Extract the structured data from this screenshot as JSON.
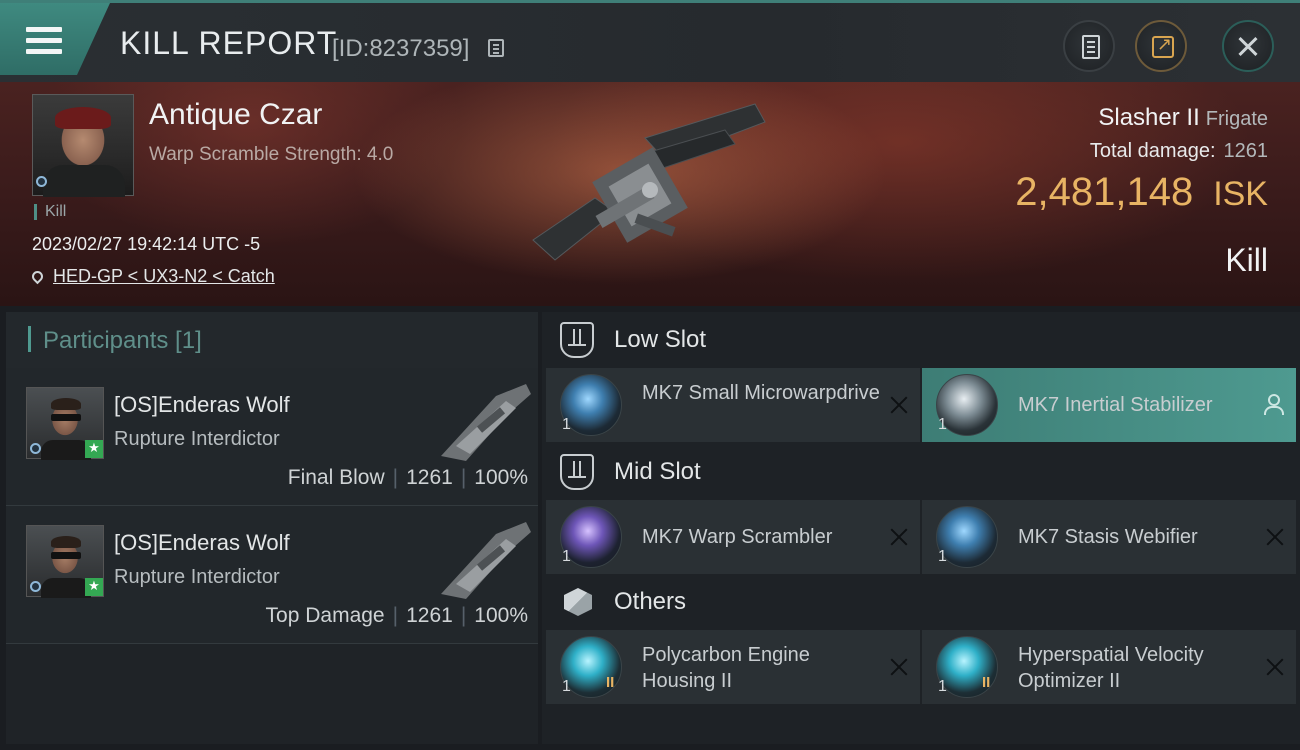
{
  "header": {
    "title": "KILL REPORT",
    "report_id": "[ID:8237359]"
  },
  "victim": {
    "name": "Antique Czar",
    "detail": "Warp Scramble Strength: 4.0",
    "kill_tag": "Kill",
    "timestamp": "2023/02/27 19:42:14 UTC -5",
    "location": "HED-GP < UX3-N2 < Catch",
    "ship_name": "Slasher II",
    "ship_class": "Frigate",
    "total_damage_label": "Total damage:",
    "total_damage": "1261",
    "isk_value": "2,481,148",
    "isk_unit": "ISK",
    "result": "Kill"
  },
  "participants": {
    "title": "Participants [1]",
    "rows": [
      {
        "name": "[OS]Enderas Wolf",
        "ship": "Rupture Interdictor",
        "role": "Final Blow",
        "damage": "1261",
        "percent": "100%"
      },
      {
        "name": "[OS]Enderas Wolf",
        "ship": "Rupture Interdictor",
        "role": "Top Damage",
        "damage": "1261",
        "percent": "100%"
      }
    ]
  },
  "fitting": {
    "low_slot_label": "Low Slot",
    "mid_slot_label": "Mid Slot",
    "others_label": "Others",
    "low": [
      {
        "name": "MK7 Small Microwarpdrive",
        "qty": "1"
      },
      {
        "name": "MK7 Inertial Stabilizer",
        "qty": "1"
      }
    ],
    "mid": [
      {
        "name": "MK7 Warp Scrambler",
        "qty": "1"
      },
      {
        "name": "MK7 Stasis Webifier",
        "qty": "1"
      }
    ],
    "others": [
      {
        "name": "Polycarbon Engine Housing II",
        "qty": "1",
        "tier": "II"
      },
      {
        "name": "Hyperspatial Velocity Optimizer II",
        "qty": "1",
        "tier": "II"
      }
    ]
  },
  "colors": {
    "accent_teal": "#4e9a90",
    "isk_gold": "#e8b464",
    "hero_red": "#4a2220"
  }
}
